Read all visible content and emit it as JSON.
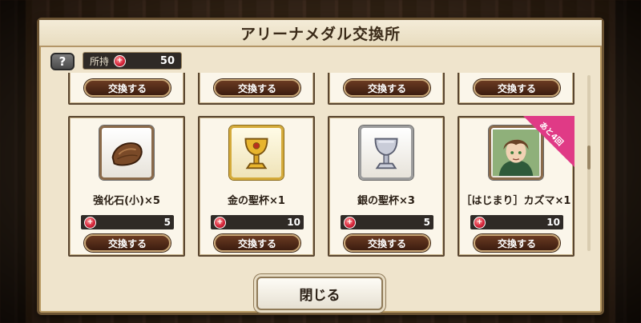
{
  "dialog": {
    "title": "アリーナメダル交換所"
  },
  "help": {
    "label": "?"
  },
  "owned": {
    "label": "所持",
    "value": "50"
  },
  "exchange_label": "交換する",
  "medal_symbol": "+",
  "items": [
    {
      "name": "強化石(小)×5",
      "cost": "5",
      "icon": "stone-icon"
    },
    {
      "name": "金の聖杯×1",
      "cost": "10",
      "icon": "gold-chalice-icon"
    },
    {
      "name": "銀の聖杯×3",
      "cost": "5",
      "icon": "silver-chalice-icon"
    },
    {
      "name": "［はじまり］カズマ×1",
      "cost": "10",
      "icon": "character-portrait-icon",
      "badge": "あと4回"
    }
  ],
  "close": {
    "label": "閉じる"
  },
  "colors": {
    "medal": "#d7263b",
    "ribbon": "#e03a86",
    "button": "#4a2616"
  }
}
